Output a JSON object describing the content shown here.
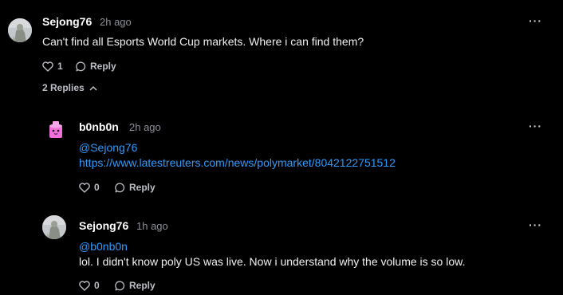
{
  "comments": [
    {
      "author": "Sejong76",
      "time": "2h ago",
      "text": "Can't find all Esports World Cup markets. Where i can find them?",
      "likes": "1",
      "reply_label": "Reply",
      "replies_toggle": "2 Replies"
    }
  ],
  "replies": [
    {
      "author": "b0nb0n",
      "time": "2h ago",
      "mention": "@Sejong76",
      "link": "https://www.latestreuters.com/news/polymarket/8042122751512",
      "likes": "0",
      "reply_label": "Reply"
    },
    {
      "author": "Sejong76",
      "time": "1h ago",
      "mention": "@b0nb0n",
      "text": "lol. I didn't know poly US was live. Now i understand why the volume is so low.",
      "likes": "0",
      "reply_label": "Reply"
    }
  ],
  "more_label": "···",
  "colors": {
    "background": "#000000",
    "link": "#2f9bff",
    "muted": "#8d8f98",
    "cup_avatar": "#f06fd8"
  },
  "icons": [
    "heart-icon",
    "chat-bubble-icon",
    "chevron-up-icon",
    "more-icon"
  ]
}
